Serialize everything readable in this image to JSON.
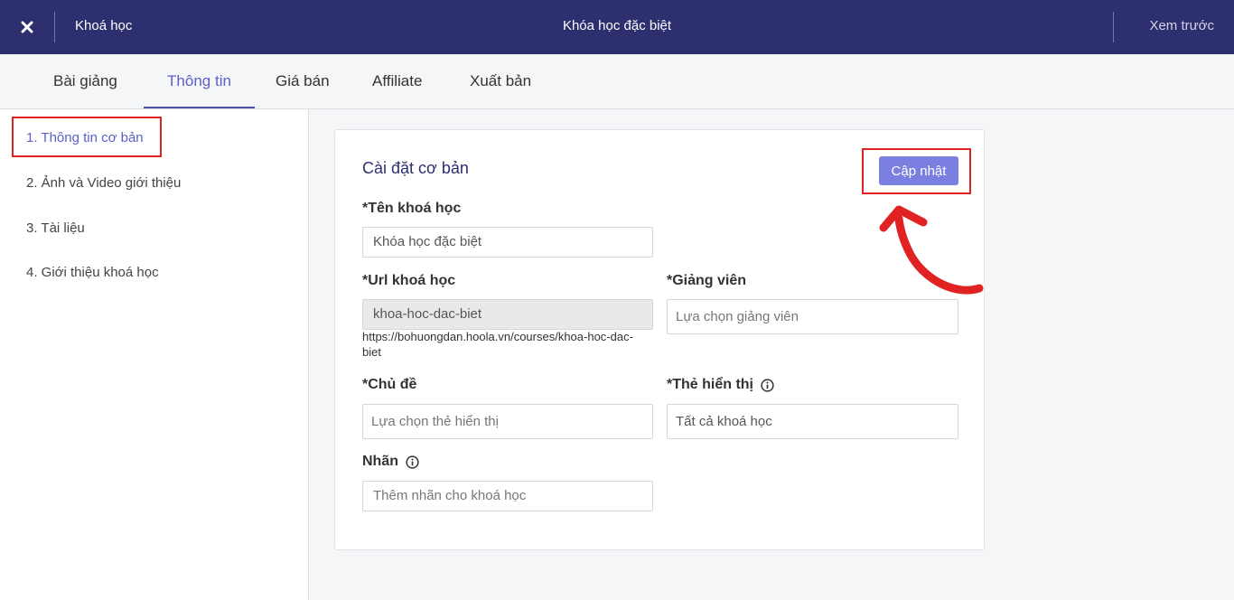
{
  "topbar": {
    "close_icon": "close-icon",
    "breadcrumb": "Khoá học",
    "title": "Khóa học đặc biệt",
    "preview": "Xem trước"
  },
  "tabs": [
    {
      "label": "Bài giảng",
      "active": false
    },
    {
      "label": "Thông tin",
      "active": true
    },
    {
      "label": "Giá bán",
      "active": false
    },
    {
      "label": "Affiliate",
      "active": false
    },
    {
      "label": "Xuất bản",
      "active": false
    }
  ],
  "sidebar": {
    "items": [
      {
        "label": "1. Thông tin cơ bản",
        "active": true
      },
      {
        "label": "2. Ảnh và Video giới thiệu",
        "active": false
      },
      {
        "label": "3. Tài liệu",
        "active": false
      },
      {
        "label": "4. Giới thiệu khoá học",
        "active": false
      }
    ]
  },
  "card": {
    "title": "Cài đặt cơ bản",
    "update_label": "Cập nhật",
    "fields": {
      "course_name": {
        "label": "*Tên khoá học",
        "value": "Khóa học đặc biệt"
      },
      "url": {
        "label": "*Url khoá học",
        "value": "khoa-hoc-dac-biet",
        "helper": "https://bohuongdan.hoola.vn/courses/khoa-hoc-dac-biet"
      },
      "instructor": {
        "label": "*Giảng viên",
        "placeholder": "Lựa chọn giảng viên"
      },
      "topic": {
        "label": "*Chủ đề",
        "placeholder": "Lựa chọn thẻ hiển thị"
      },
      "display_tag": {
        "label": "*Thẻ hiển thị",
        "value": "Tất cả khoá học"
      },
      "label": {
        "label": "Nhãn",
        "placeholder": "Thêm nhãn cho khoá học"
      }
    }
  },
  "colors": {
    "topbar": "#2d2f6e",
    "accent": "#5b5fc7",
    "button": "#7b7fe0",
    "highlight": "#e02222"
  }
}
